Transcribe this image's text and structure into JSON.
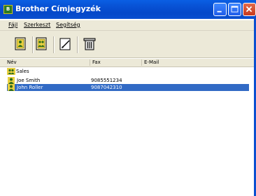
{
  "window": {
    "title": "Brother Címjegyzék",
    "title_icon_letter": "B"
  },
  "menu": {
    "items": [
      "Fájl",
      "Szerkeszt",
      "Segítség"
    ]
  },
  "toolbar": {
    "buttons": [
      "new-contact-icon",
      "new-group-icon",
      "edit-icon",
      "delete-icon"
    ]
  },
  "list": {
    "columns": [
      "Név",
      "Fax",
      "E-Mail"
    ],
    "group": {
      "name": "Sales"
    },
    "contacts": [
      {
        "name": "Joe Smith",
        "fax": "9085551234",
        "email": "",
        "selected": false
      },
      {
        "name": "John Roller",
        "fax": "9087042310",
        "email": "",
        "selected": true
      }
    ]
  },
  "colors": {
    "titlebar": "#0853d6",
    "selection": "#316ac5",
    "chrome": "#ece9d8"
  }
}
